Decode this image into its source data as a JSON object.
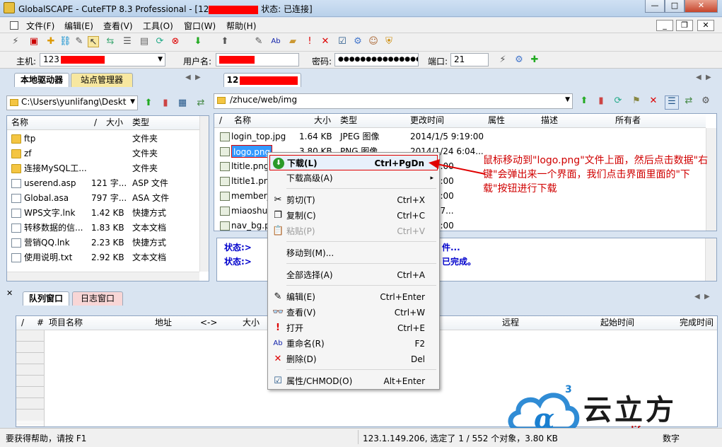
{
  "window": {
    "title_prefix": "GlobalSCAPE - CuteFTP 8.3 Professional - [12",
    "title_suffix": "状态: 已连接]",
    "min": "—",
    "max": "□",
    "close": "✕"
  },
  "menu": [
    "文件(F)",
    "编辑(E)",
    "查看(V)",
    "工具(O)",
    "窗口(W)",
    "帮助(H)"
  ],
  "mdi": {
    "min": "_",
    "restore": "❐",
    "close": "✕"
  },
  "connection": {
    "host_label": "主机:",
    "host_value": "123",
    "user_label": "用户名:",
    "password_label": "密码:",
    "password_value": "●●●●●●●●●●●●●●●",
    "port_label": "端口:",
    "port_value": "21"
  },
  "left_pane": {
    "tabs": [
      "本地驱动器",
      "站点管理器"
    ],
    "path": "C:\\Users\\yunlifang\\Deskt",
    "columns": [
      "名称",
      "/",
      "大小",
      "类型"
    ],
    "files": [
      {
        "name": "ftp",
        "size": "",
        "type": "文件夹",
        "icon": "folder"
      },
      {
        "name": "zf",
        "size": "",
        "type": "文件夹",
        "icon": "folder"
      },
      {
        "name": "连接MySQL工...",
        "size": "",
        "type": "文件夹",
        "icon": "folder"
      },
      {
        "name": "userend.asp",
        "size": "121 字...",
        "type": "ASP 文件",
        "icon": "doc"
      },
      {
        "name": "Global.asa",
        "size": "797 字...",
        "type": "ASA 文件",
        "icon": "doc"
      },
      {
        "name": "WPS文字.lnk",
        "size": "1.42 KB",
        "type": "快捷方式",
        "icon": "doc"
      },
      {
        "name": "转移数据的信...",
        "size": "1.83 KB",
        "type": "文本文档",
        "icon": "doc"
      },
      {
        "name": "营销QQ.lnk",
        "size": "2.23 KB",
        "type": "快捷方式",
        "icon": "doc"
      },
      {
        "name": "使用说明.txt",
        "size": "2.92 KB",
        "type": "文本文档",
        "icon": "doc"
      }
    ]
  },
  "right_pane": {
    "tab": "12",
    "path": "/zhuce/web/img",
    "columns": [
      "/",
      "名称",
      "大小",
      "类型",
      "更改时间",
      "属性",
      "描述",
      "所有者"
    ],
    "files": [
      {
        "name": "login_top.jpg",
        "size": "1.64 KB",
        "type": "JPEG 图像",
        "time": "2014/1/5 9:19:00"
      },
      {
        "name": "logo.png",
        "size": "3.80 KB",
        "type": "PNG 图像",
        "time": "2014/1/24 6:04..."
      },
      {
        "name": "ltitle.png",
        "size": "",
        "type": "",
        "time": "/4 7:34:00"
      },
      {
        "name": "ltitle1.png",
        "size": "",
        "type": "",
        "time": "/4 7:34:00"
      },
      {
        "name": "member_...",
        "size": "",
        "type": "",
        "time": "/4 7:46:00"
      },
      {
        "name": "miaoshu_...",
        "size": "",
        "type": "",
        "time": "/11 8:07..."
      },
      {
        "name": "nav_bg.p...",
        "size": "",
        "type": "",
        "time": "/4 7:58:00"
      }
    ],
    "log": [
      {
        "label": "状态:>",
        "text": "件..."
      },
      {
        "label": "状态:>",
        "text": "已完成。"
      }
    ]
  },
  "queue": {
    "tabs": [
      "队列窗口",
      "日志窗口"
    ],
    "columns": [
      "/",
      "#",
      "项目名称",
      "地址",
      "<->",
      "大小",
      "远程",
      "起始时间",
      "完成时间"
    ]
  },
  "context_menu": [
    {
      "label": "下载(L)",
      "shortcut": "Ctrl+PgDn",
      "icon": "download-icon",
      "glyph": "⬇",
      "bold": true
    },
    {
      "label": "下载高级(A)",
      "shortcut": "▸",
      "icon": "",
      "glyph": ""
    },
    {
      "sep": true
    },
    {
      "label": "剪切(T)",
      "shortcut": "Ctrl+X",
      "icon": "cut-icon",
      "glyph": "✂"
    },
    {
      "label": "复制(C)",
      "shortcut": "Ctrl+C",
      "icon": "copy-icon",
      "glyph": "❐"
    },
    {
      "label": "粘贴(P)",
      "shortcut": "Ctrl+V",
      "icon": "paste-icon",
      "glyph": "📋",
      "disabled": true
    },
    {
      "sep": true
    },
    {
      "label": "移动到(M)...",
      "shortcut": "",
      "icon": "",
      "glyph": ""
    },
    {
      "sep": true
    },
    {
      "label": "全部选择(A)",
      "shortcut": "Ctrl+A",
      "icon": "",
      "glyph": ""
    },
    {
      "sep": true
    },
    {
      "label": "编辑(E)",
      "shortcut": "Ctrl+Enter",
      "icon": "edit-icon",
      "glyph": "✎"
    },
    {
      "label": "查看(V)",
      "shortcut": "Ctrl+W",
      "icon": "view-icon",
      "glyph": "👓"
    },
    {
      "label": "打开",
      "shortcut": "Ctrl+E",
      "icon": "open-icon",
      "glyph": "!"
    },
    {
      "label": "重命名(R)",
      "shortcut": "F2",
      "icon": "rename-icon",
      "glyph": "Ab"
    },
    {
      "label": "删除(D)",
      "shortcut": "Del",
      "icon": "delete-icon",
      "glyph": "✕"
    },
    {
      "sep": true
    },
    {
      "label": "属性/CHMOD(O)",
      "shortcut": "Alt+Enter",
      "icon": "properties-icon",
      "glyph": "☑"
    }
  ],
  "annotation": "鼠标移动到\"logo.png\"文件上面，然后点击数据\"右键\"会弹出来一个界面，我们点击界面里面的\"下载\"按钮进行下载",
  "watermark": {
    "brand": "云立方",
    "url": "www.yunlifang.cn",
    "sup": "3"
  },
  "status": {
    "help": "要获得帮助，请按 F1",
    "info": "123.1.149.206, 选定了 1 / 552 个对象，3.80 KB",
    "count": "数字"
  }
}
